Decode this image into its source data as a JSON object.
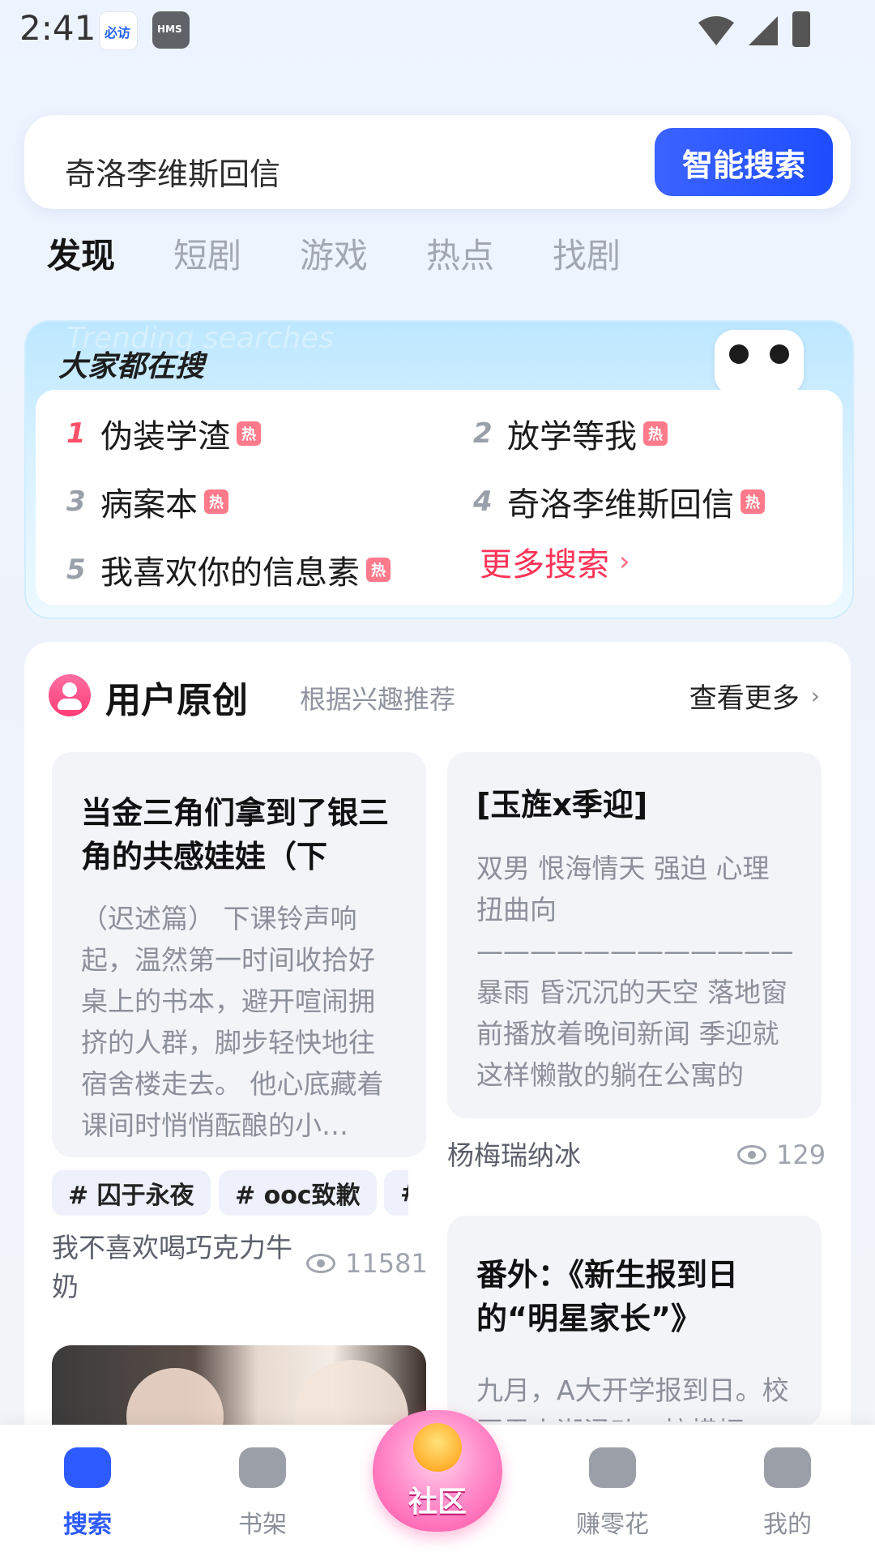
{
  "status_bar": {
    "time": "2:41",
    "apps": [
      {
        "icon": "bixun-app-icon",
        "label": "必访"
      },
      {
        "icon": "hms-app-icon",
        "label": "HMS"
      }
    ],
    "icons": [
      "wifi-icon",
      "signal-icon",
      "battery-icon"
    ]
  },
  "search": {
    "query": "奇洛李维斯回信",
    "button_label": "智能搜索"
  },
  "tabs": [
    "发现",
    "短剧",
    "游戏",
    "热点",
    "找剧"
  ],
  "trending": {
    "title": "大家都在搜",
    "subtitle": "Trending searches",
    "hot_badge": "热",
    "items": [
      {
        "rank": "1",
        "text": "伪装学渣"
      },
      {
        "rank": "2",
        "text": "放学等我"
      },
      {
        "rank": "3",
        "text": "病案本"
      },
      {
        "rank": "4",
        "text": "奇洛李维斯回信"
      },
      {
        "rank": "5",
        "text": "我喜欢你的信息素"
      }
    ],
    "more_label": "更多搜索"
  },
  "ugc": {
    "title": "用户原创",
    "subtitle": "根据兴趣推荐",
    "more_label": "查看更多",
    "posts": [
      {
        "title": "当金三角们拿到了银三角的共感娃娃（下",
        "excerpt": "（迟述篇） 下课铃声响起，温然第一时间收拾好桌上的书本，避开喧闹拥挤的人群，脚步轻快地往宿舍楼走去。 他心底藏着课间时悄悄酝酿的小…",
        "tags": [
          "# 囚于永夜",
          "# ooc致歉",
          "#"
        ],
        "author": "我不喜欢喝巧克力牛奶",
        "views": "11581"
      },
      {
        "title": "[玉旌x季迎]",
        "excerpt": "双男 恨海情天 强迫 心理扭曲向 ———————————————— 暴雨 昏沉沉的天空 落地窗前播放着晚间新闻 季迎就这样懒散的躺在公寓的沙…",
        "author": "杨梅瑞纳冰",
        "views": "129"
      },
      {
        "title": "番外：《新生报到日的“明星家长”》",
        "excerpt": "九月，A大开学报到日。校园里人潮涌动，拉横幅…"
      }
    ]
  },
  "bottom_nav": [
    {
      "label": "搜索",
      "icon": "search-tab-icon",
      "active": true
    },
    {
      "label": "书架",
      "icon": "bookshelf-icon",
      "active": false
    },
    {
      "label": "社区",
      "icon": "community-icon",
      "active": false
    },
    {
      "label": "赚零花",
      "icon": "earn-icon",
      "active": false
    },
    {
      "label": "我的",
      "icon": "profile-icon",
      "active": false
    }
  ],
  "colors": {
    "accent": "#2e5bff",
    "hot": "#ff3357",
    "community": "#ff4fa3"
  }
}
